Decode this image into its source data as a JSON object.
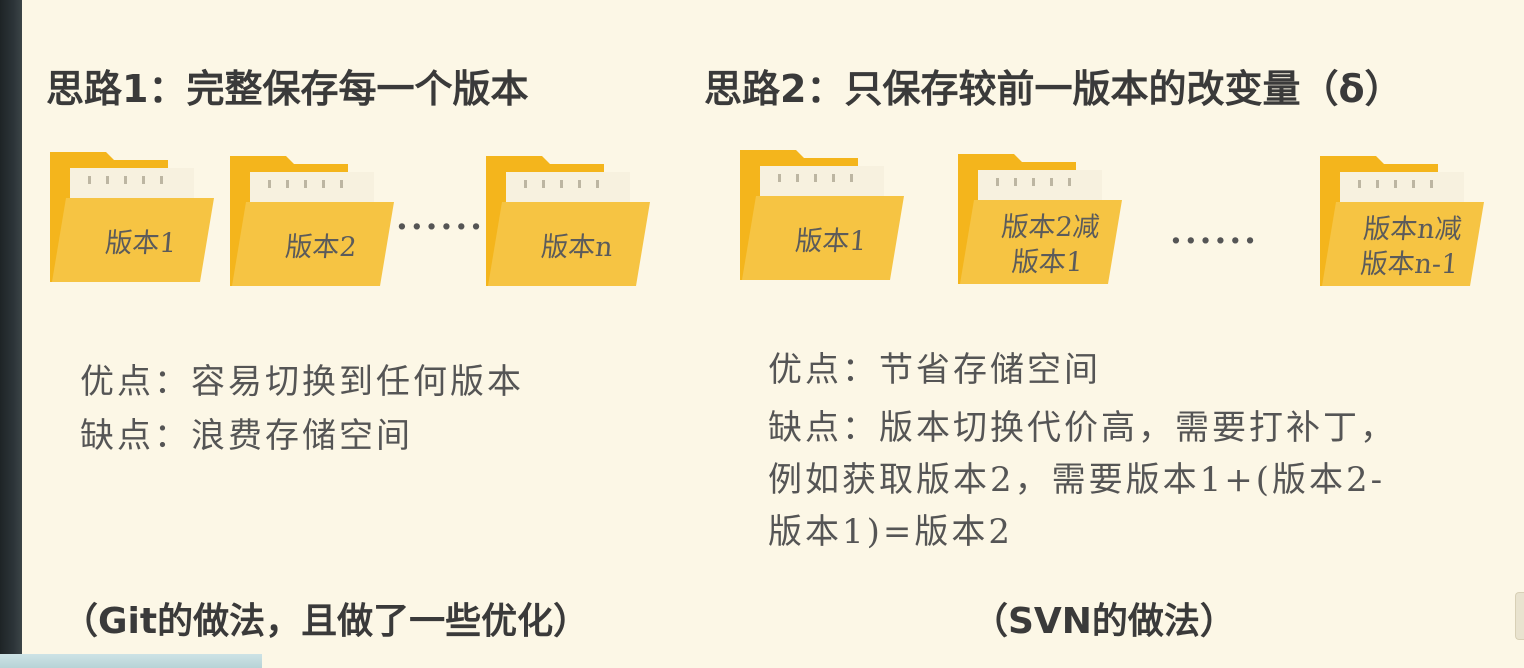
{
  "left": {
    "heading": "思路1：完整保存每一个版本",
    "folders": [
      "版本1",
      "版本2",
      "版本n"
    ],
    "ellipsis": "......",
    "pros": "优点：容易切换到任何版本",
    "cons": "缺点：浪费存储空间",
    "note": "（Git的做法，且做了一些优化）"
  },
  "right": {
    "heading": "思路2：只保存较前一版本的改变量（δ）",
    "folders": [
      "版本1",
      "版本2减\n版本1",
      "版本n减\n版本n-1"
    ],
    "ellipsis": "......",
    "pros": "优点：节省存储空间",
    "cons": "缺点：版本切换代价高，需要打补丁，\n例如获取版本2，需要版本1+(版本2-\n版本1)=版本2",
    "note": "（SVN的做法）"
  },
  "colors": {
    "background": "#fcf7e6",
    "folder_back": "#f4b51c",
    "folder_front": "#f6c443",
    "paper": "#f7f1df"
  }
}
